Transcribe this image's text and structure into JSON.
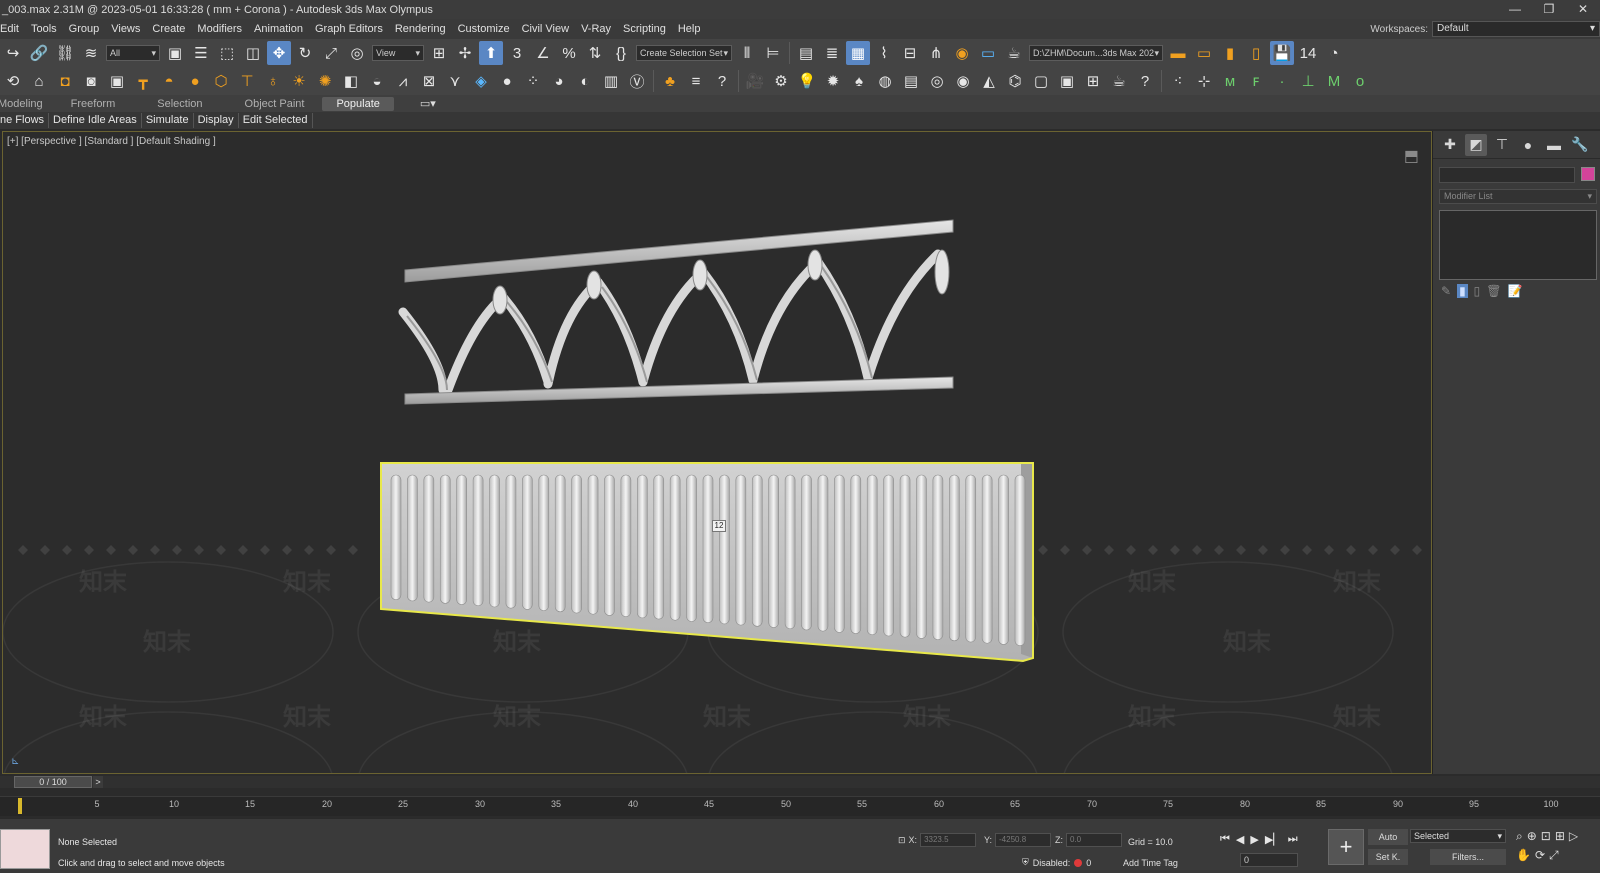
{
  "window": {
    "title": "_003.max  2.31M @ 2023-05-01 16:33:28  ( mm + Corona ) - Autodesk 3ds Max Olympus",
    "controls": [
      "—",
      "❐",
      "✕"
    ]
  },
  "menu": [
    "Edit",
    "Tools",
    "Group",
    "Views",
    "Create",
    "Modifiers",
    "Animation",
    "Graph Editors",
    "Rendering",
    "Customize",
    "Civil View",
    "V-Ray",
    "Scripting",
    "Help"
  ],
  "workspaces": {
    "label": "Workspaces:",
    "value": "Default"
  },
  "toolbar1": {
    "filter_value": "All",
    "refcoord_value": "View",
    "selection_set_value": "Create Selection Set",
    "project_path": "D:\\ZHM\\Docum...3ds Max 202",
    "badge": "14"
  },
  "ribbon": {
    "tabs": [
      "Modeling",
      "Freeform",
      "Selection",
      "Object Paint",
      "Populate"
    ],
    "active_tab": "Populate",
    "buttons": [
      "ne Flows",
      "Define Idle Areas",
      "Simulate",
      "Display",
      "Edit Selected"
    ]
  },
  "viewport": {
    "label": "[+] [Perspective ] [Standard ] [Default Shading ]",
    "object_tag": "12",
    "watermark": "知末",
    "selection_color": "#e8e84a"
  },
  "command_panel": {
    "modifier_list": "Modifier List",
    "object_color": "#d3449a"
  },
  "timeline": {
    "slider": "0 / 100",
    "arrow": ">",
    "ticks": [
      "5",
      "10",
      "15",
      "20",
      "25",
      "30",
      "35",
      "40",
      "45",
      "50",
      "55",
      "60",
      "65",
      "70",
      "75",
      "80",
      "85",
      "90",
      "95",
      "100"
    ]
  },
  "status": {
    "selection": "None Selected",
    "prompt": "Click and drag to select and move objects",
    "x_label": "X:",
    "x_value": "3323.5",
    "y_label": "Y:",
    "y_value": "-4250.8",
    "z_label": "Z:",
    "z_value": "0.0",
    "grid": "Grid = 10.0",
    "disabled": "Disabled:",
    "disabled_count": "0",
    "time_tag": "Add Time Tag",
    "frame": "0",
    "auto": "Auto",
    "set_key": "Set K.",
    "selected": "Selected",
    "filters": "Filters..."
  }
}
